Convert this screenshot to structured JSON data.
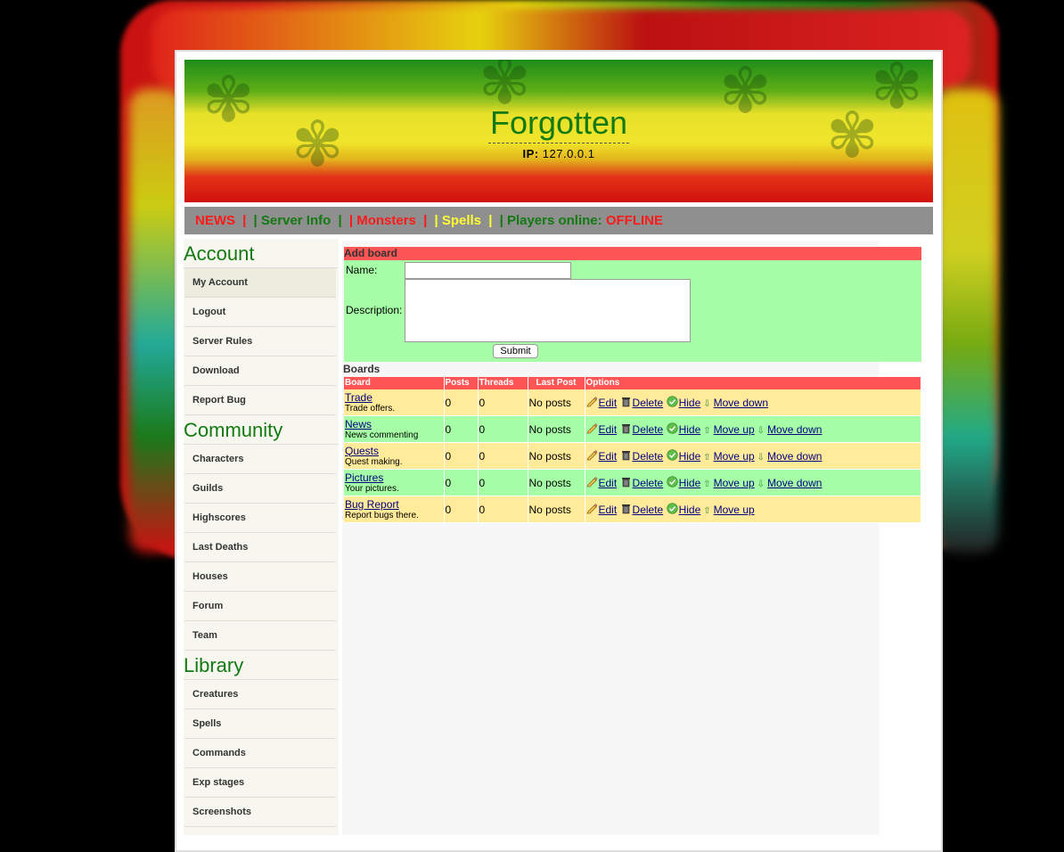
{
  "site": {
    "title": "Forgotten",
    "ip_label": "IP:",
    "ip_value": "127.0.0.1"
  },
  "nav": {
    "news": "NEWS",
    "server_info": "Server Info",
    "monsters": "Monsters",
    "spells": "Spells",
    "players_online_label": "Players online:",
    "players_online_status": "OFFLINE",
    "separator": "|"
  },
  "sidebar": {
    "account_heading": "Account",
    "account_items": [
      "My Account",
      "Logout",
      "Server Rules",
      "Download",
      "Report Bug"
    ],
    "community_heading": "Community",
    "community_items": [
      "Characters",
      "Guilds",
      "Highscores",
      "Last Deaths",
      "Houses",
      "Forum",
      "Team"
    ],
    "library_heading": "Library",
    "library_items": [
      "Creatures",
      "Spells",
      "Commands",
      "Exp stages",
      "Screenshots"
    ]
  },
  "add_board": {
    "heading": "Add board",
    "name_label": "Name:",
    "name_value": "",
    "description_label": "Description:",
    "description_value": "",
    "submit_label": "Submit"
  },
  "boards": {
    "heading": "Boards",
    "columns": [
      "Board",
      "Posts",
      "Threads",
      "Last Post",
      "Options"
    ],
    "rows": [
      {
        "name": "Trade",
        "description": "Trade offers.",
        "posts": "0",
        "threads": "0",
        "last_post": "No posts"
      },
      {
        "name": "News",
        "description": "News commenting",
        "posts": "0",
        "threads": "0",
        "last_post": "No posts"
      },
      {
        "name": "Quests",
        "description": "Quest making.",
        "posts": "0",
        "threads": "0",
        "last_post": "No posts"
      },
      {
        "name": "Pictures",
        "description": "Your pictures.",
        "posts": "0",
        "threads": "0",
        "last_post": "No posts"
      },
      {
        "name": "Bug Report",
        "description": "Report bugs there.",
        "posts": "0",
        "threads": "0",
        "last_post": "No posts"
      }
    ],
    "options": {
      "edit": "Edit",
      "delete": "Delete",
      "hide": "Hide",
      "move_up": "Move up",
      "move_down": "Move down"
    }
  },
  "colors": {
    "header_red": "#ff5555",
    "row_yellow": "#ffeb99",
    "row_green": "#a6ffa6",
    "nav_gray": "#8f8f8f",
    "title_green": "#137a13"
  }
}
